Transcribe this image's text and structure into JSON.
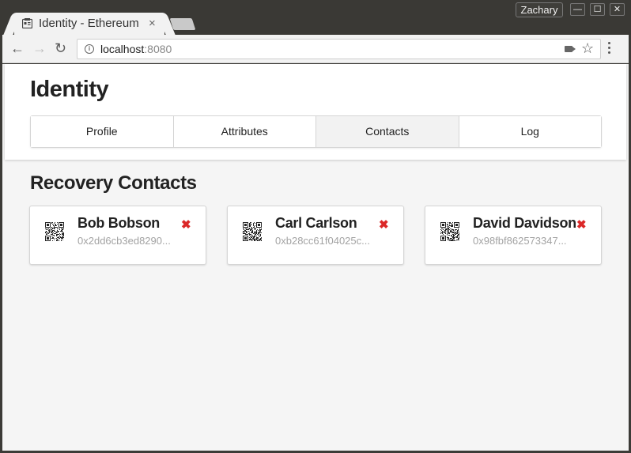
{
  "browser": {
    "tab_title": "Identity - Ethereum",
    "tab_close": "×",
    "profile_name": "Zachary",
    "url_host": "localhost",
    "url_port": ":8080",
    "window_buttons": [
      "—",
      "☐",
      "✕"
    ]
  },
  "app": {
    "title": "Identity",
    "menu": [
      {
        "label": "Profile",
        "active": false
      },
      {
        "label": "Attributes",
        "active": false
      },
      {
        "label": "Contacts",
        "active": true
      },
      {
        "label": "Log",
        "active": false
      }
    ],
    "section_title": "Recovery Contacts",
    "contacts": [
      {
        "name": "Bob Bobson",
        "address": "0x2dd6cb3ed8290..."
      },
      {
        "name": "Carl Carlson",
        "address": "0xb28cc61f04025c..."
      },
      {
        "name": "David Davidson",
        "address": "0x98fbf862573347..."
      }
    ],
    "remove_glyph": "✖",
    "colors": {
      "remove": "#db2828",
      "active_menu": "#f2f2f2"
    }
  }
}
